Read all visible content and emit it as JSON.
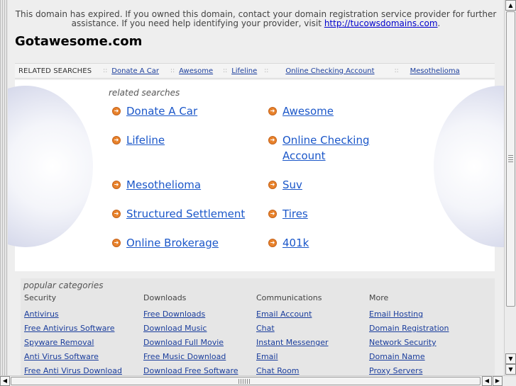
{
  "notice": {
    "text": "This domain has expired. If you owned this domain, contact your domain registration service provider for further assistance. If you need help identifying your provider, visit",
    "link": "http://tucowsdomains.com",
    "tail": "."
  },
  "site_title": "Gotawesome.com",
  "topbar": {
    "label": "RELATED SEARCHES",
    "separator": "::",
    "links": [
      "Donate A Car",
      "Awesome",
      "Lifeline",
      "Online Checking Account",
      "Mesothelioma"
    ]
  },
  "related": {
    "heading": "related searches",
    "arrow_icon": "arrow-right-circle-icon",
    "accent": "#e8822b",
    "links": [
      "Donate A Car",
      "Awesome",
      "Lifeline",
      "Online Checking Account",
      "Mesothelioma",
      "Suv",
      "Structured Settlement",
      "Tires",
      "Online Brokerage",
      "401k"
    ]
  },
  "popular": {
    "heading": "popular categories",
    "columns": [
      {
        "head": "Security",
        "links": [
          "Antivirus",
          "Free Antivirus Software",
          "Spyware Removal",
          "Anti Virus Software",
          "Free Anti Virus Download"
        ]
      },
      {
        "head": "Downloads",
        "links": [
          "Free Downloads",
          "Download Music",
          "Download Full Movie",
          "Free Music Download",
          "Download Free Software"
        ]
      },
      {
        "head": "Communications",
        "links": [
          "Email Account",
          "Chat",
          "Instant Messenger",
          "Email",
          "Chat Room"
        ]
      },
      {
        "head": "More",
        "links": [
          "Email Hosting",
          "Domain Registration",
          "Network Security",
          "Domain Name",
          "Proxy Servers"
        ]
      }
    ]
  },
  "scrollbars": {
    "up": "▲",
    "down": "▼",
    "down2": "▼",
    "left": "◀",
    "right": "▶"
  }
}
